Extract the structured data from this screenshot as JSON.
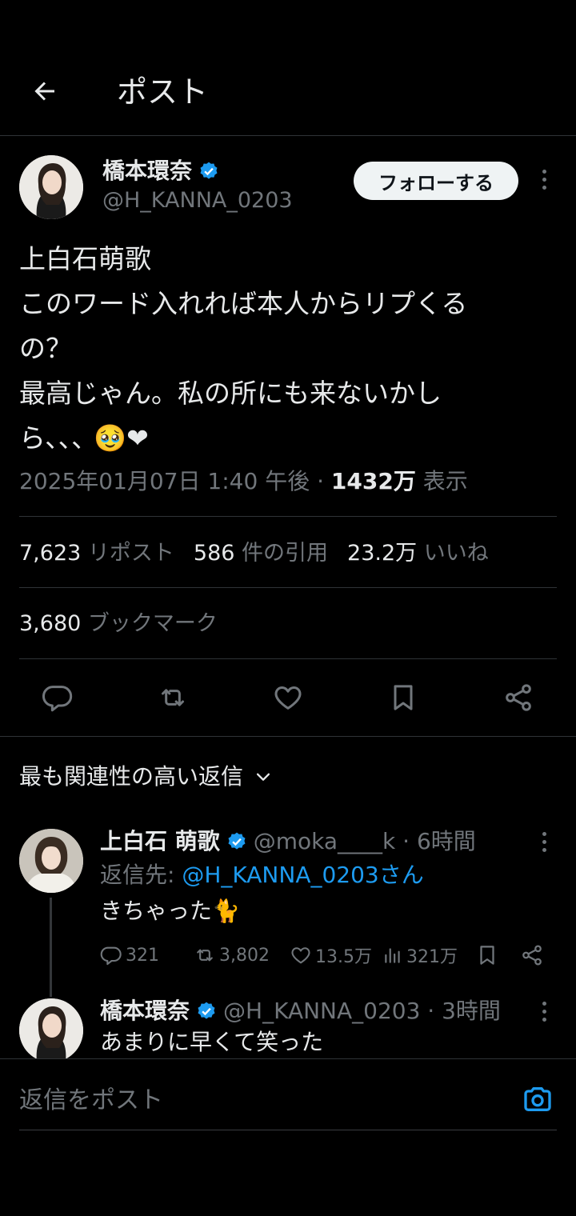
{
  "header": {
    "title": "ポスト"
  },
  "post": {
    "author_name": "橋本環奈",
    "author_handle": "@H_KANNA_0203",
    "follow_label": "フォローする",
    "text_lines": [
      "上白石萌歌",
      "このワード入れれば本人からリプくる",
      "の？",
      "最高じゃん。私の所にも来ないかし",
      "ら､､､ 🥹❤"
    ],
    "timestamp": "2025年01月07日 1:40 午後",
    "separator": " · ",
    "views_count": "1432万",
    "views_label": " 表示"
  },
  "stats": {
    "reposts_count": "7,623",
    "reposts_label": " リポスト",
    "quotes_count": "586",
    "quotes_label": " 件の引用",
    "likes_count": "23.2万",
    "likes_label": " いいね",
    "bookmarks_count": "3,680",
    "bookmarks_label": " ブックマーク"
  },
  "sort": {
    "label": "最も関連性の高い返信"
  },
  "replies": [
    {
      "name": "上白石 萌歌",
      "handle": "@moka____k",
      "time": " · 6時間",
      "reply_to_prefix": "返信先: ",
      "reply_to_handle": "@H_KANNA_0203さん",
      "text": "きちゃった🐈",
      "replies": "321",
      "reposts": "3,802",
      "likes": "13.5万",
      "views": "321万"
    },
    {
      "name": "橋本環奈",
      "handle": "@H_KANNA_0203",
      "time": " · 3時間",
      "text": "あまりに早くて笑った"
    }
  ],
  "composer": {
    "placeholder": "返信をポスト"
  },
  "colors": {
    "accent": "#1d9bf0",
    "background": "#000000",
    "muted": "#71767b"
  },
  "icons": [
    "back-arrow-icon",
    "verified-badge-icon",
    "more-icon",
    "reply-icon",
    "repost-icon",
    "like-icon",
    "bookmark-icon",
    "share-icon",
    "chevron-down-icon",
    "views-icon",
    "camera-icon"
  ]
}
